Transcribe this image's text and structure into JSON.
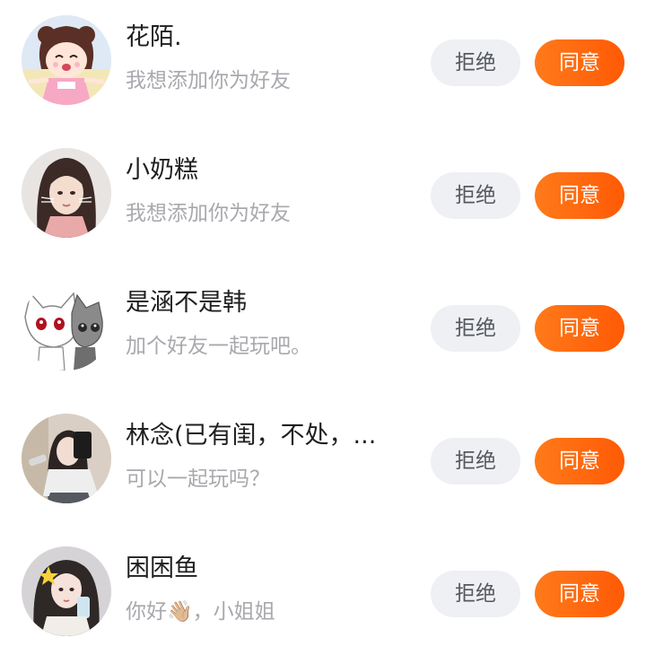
{
  "requests": [
    {
      "name": "花陌.",
      "message": "我想添加你为好友",
      "avatar": "cartoon-girl-avatar",
      "reject_label": "拒绝",
      "accept_label": "同意"
    },
    {
      "name": "小奶糕",
      "message": "我想添加你为好友",
      "avatar": "girl-photo-avatar",
      "reject_label": "拒绝",
      "accept_label": "同意"
    },
    {
      "name": "是涵不是韩",
      "message": "加个好友一起玩吧。",
      "avatar": "cartoon-cats-avatar",
      "reject_label": "拒绝",
      "accept_label": "同意"
    },
    {
      "name": "林念(已有闺，不处，...",
      "message": "可以一起玩吗？",
      "avatar": "mirror-selfie-avatar",
      "reject_label": "拒绝",
      "accept_label": "同意"
    },
    {
      "name": "困困鱼",
      "message": "你好👋🏼，小姐姐",
      "avatar": "girl-selfie-avatar",
      "reject_label": "拒绝",
      "accept_label": "同意"
    }
  ],
  "colors": {
    "accept_bg": "#ff6a10",
    "reject_bg": "#eef0f4",
    "name_text": "#1f1f1f",
    "message_text": "#a8a8ae"
  }
}
